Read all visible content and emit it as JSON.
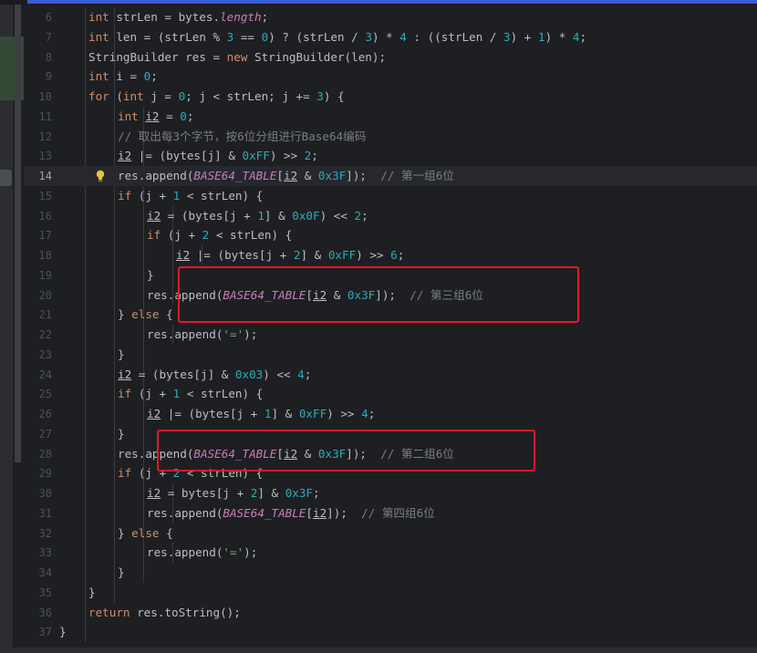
{
  "editor": {
    "lines": [
      {
        "n": "6",
        "indent": 2,
        "tokens": [
          [
            "k",
            "int"
          ],
          [
            "p",
            " strLen = bytes."
          ],
          [
            "f",
            "length"
          ],
          [
            "p",
            ";"
          ]
        ]
      },
      {
        "n": "7",
        "indent": 2,
        "tokens": [
          [
            "k",
            "int"
          ],
          [
            "p",
            " len = (strLen % "
          ],
          [
            "n",
            "3"
          ],
          [
            "p",
            " == "
          ],
          [
            "n",
            "0"
          ],
          [
            "p",
            ") ? (strLen / "
          ],
          [
            "n",
            "3"
          ],
          [
            "p",
            ") * "
          ],
          [
            "n",
            "4"
          ],
          [
            "p",
            " : ((strLen / "
          ],
          [
            "n",
            "3"
          ],
          [
            "p",
            ") + "
          ],
          [
            "n",
            "1"
          ],
          [
            "p",
            ") * "
          ],
          [
            "n",
            "4"
          ],
          [
            "p",
            ";"
          ]
        ]
      },
      {
        "n": "8",
        "indent": 2,
        "tokens": [
          [
            "p",
            "StringBuilder res = "
          ],
          [
            "k",
            "new"
          ],
          [
            "p",
            " StringBuilder(len);"
          ]
        ]
      },
      {
        "n": "9",
        "indent": 2,
        "tokens": [
          [
            "k",
            "int"
          ],
          [
            "p",
            " i = "
          ],
          [
            "n",
            "0"
          ],
          [
            "p",
            ";"
          ]
        ]
      },
      {
        "n": "10",
        "indent": 2,
        "tokens": [
          [
            "k",
            "for"
          ],
          [
            "p",
            " ("
          ],
          [
            "k",
            "int"
          ],
          [
            "p",
            " j = "
          ],
          [
            "n",
            "0"
          ],
          [
            "p",
            "; j < strLen; j += "
          ],
          [
            "n",
            "3"
          ],
          [
            "p",
            ") {"
          ]
        ]
      },
      {
        "n": "11",
        "indent": 3,
        "tokens": [
          [
            "k",
            "int"
          ],
          [
            "p",
            " "
          ],
          [
            "u",
            "i2"
          ],
          [
            "p",
            " = "
          ],
          [
            "n",
            "0"
          ],
          [
            "p",
            ";"
          ]
        ]
      },
      {
        "n": "12",
        "indent": 3,
        "tokens": [
          [
            "c",
            "// 取出每3个字节，按6位分组进行Base64编码"
          ]
        ]
      },
      {
        "n": "13",
        "indent": 3,
        "tokens": [
          [
            "u",
            "i2"
          ],
          [
            "p",
            " |= (bytes[j] & "
          ],
          [
            "n",
            "0xFF"
          ],
          [
            "p",
            ") >> "
          ],
          [
            "n",
            "2"
          ],
          [
            "p",
            ";"
          ]
        ]
      },
      {
        "n": "14",
        "indent": 3,
        "bulb": true,
        "current": true,
        "tokens": [
          [
            "p",
            "res.append("
          ],
          [
            "s",
            "BASE64_TABLE"
          ],
          [
            "p",
            "["
          ],
          [
            "u",
            "i2"
          ],
          [
            "p",
            " & "
          ],
          [
            "n",
            "0x3F"
          ],
          [
            "p",
            "]);  "
          ],
          [
            "c",
            "// 第一组6位"
          ]
        ]
      },
      {
        "n": "15",
        "indent": 3,
        "tokens": [
          [
            "k",
            "if"
          ],
          [
            "p",
            " (j + "
          ],
          [
            "n",
            "1"
          ],
          [
            "p",
            " < strLen) {"
          ]
        ]
      },
      {
        "n": "16",
        "indent": 4,
        "tokens": [
          [
            "u",
            "i2"
          ],
          [
            "p",
            " = (bytes[j + "
          ],
          [
            "n",
            "1"
          ],
          [
            "p",
            "] & "
          ],
          [
            "n",
            "0x0F"
          ],
          [
            "p",
            ") << "
          ],
          [
            "n",
            "2"
          ],
          [
            "p",
            ";"
          ]
        ]
      },
      {
        "n": "17",
        "indent": 4,
        "tokens": [
          [
            "k",
            "if"
          ],
          [
            "p",
            " (j + "
          ],
          [
            "n",
            "2"
          ],
          [
            "p",
            " < strLen) {"
          ]
        ]
      },
      {
        "n": "18",
        "indent": 5,
        "tokens": [
          [
            "u",
            "i2"
          ],
          [
            "p",
            " |= (bytes[j + "
          ],
          [
            "n",
            "2"
          ],
          [
            "p",
            "] & "
          ],
          [
            "n",
            "0xFF"
          ],
          [
            "p",
            ") >> "
          ],
          [
            "n",
            "6"
          ],
          [
            "p",
            ";"
          ]
        ]
      },
      {
        "n": "19",
        "indent": 4,
        "tokens": [
          [
            "p",
            "}"
          ]
        ]
      },
      {
        "n": "20",
        "indent": 4,
        "tokens": [
          [
            "p",
            "res.append("
          ],
          [
            "s",
            "BASE64_TABLE"
          ],
          [
            "p",
            "["
          ],
          [
            "u",
            "i2"
          ],
          [
            "p",
            " & "
          ],
          [
            "n",
            "0x3F"
          ],
          [
            "p",
            "]);  "
          ],
          [
            "c",
            "// 第三组6位"
          ]
        ]
      },
      {
        "n": "21",
        "indent": 3,
        "tokens": [
          [
            "p",
            "} "
          ],
          [
            "k",
            "else"
          ],
          [
            "p",
            " {"
          ]
        ]
      },
      {
        "n": "22",
        "indent": 4,
        "tokens": [
          [
            "p",
            "res.append("
          ],
          [
            "g",
            "'='"
          ],
          [
            "p",
            ");"
          ]
        ]
      },
      {
        "n": "23",
        "indent": 3,
        "tokens": [
          [
            "p",
            "}"
          ]
        ]
      },
      {
        "n": "24",
        "indent": 3,
        "tokens": [
          [
            "u",
            "i2"
          ],
          [
            "p",
            " = (bytes[j] & "
          ],
          [
            "n",
            "0x03"
          ],
          [
            "p",
            ") << "
          ],
          [
            "n",
            "4"
          ],
          [
            "p",
            ";"
          ]
        ]
      },
      {
        "n": "25",
        "indent": 3,
        "tokens": [
          [
            "k",
            "if"
          ],
          [
            "p",
            " (j + "
          ],
          [
            "n",
            "1"
          ],
          [
            "p",
            " < strLen) {"
          ]
        ]
      },
      {
        "n": "26",
        "indent": 4,
        "tokens": [
          [
            "u",
            "i2"
          ],
          [
            "p",
            " |= (bytes[j + "
          ],
          [
            "n",
            "1"
          ],
          [
            "p",
            "] & "
          ],
          [
            "n",
            "0xFF"
          ],
          [
            "p",
            ") >> "
          ],
          [
            "n",
            "4"
          ],
          [
            "p",
            ";"
          ]
        ]
      },
      {
        "n": "27",
        "indent": 3,
        "tokens": [
          [
            "p",
            "}"
          ]
        ]
      },
      {
        "n": "28",
        "indent": 3,
        "tokens": [
          [
            "p",
            "res.append("
          ],
          [
            "s",
            "BASE64_TABLE"
          ],
          [
            "p",
            "["
          ],
          [
            "u",
            "i2"
          ],
          [
            "p",
            " & "
          ],
          [
            "n",
            "0x3F"
          ],
          [
            "p",
            "]);  "
          ],
          [
            "c",
            "// 第二组6位"
          ]
        ]
      },
      {
        "n": "29",
        "indent": 3,
        "tokens": [
          [
            "k",
            "if"
          ],
          [
            "p",
            " (j + "
          ],
          [
            "n",
            "2"
          ],
          [
            "p",
            " < strLen) {"
          ]
        ]
      },
      {
        "n": "30",
        "indent": 4,
        "tokens": [
          [
            "u",
            "i2"
          ],
          [
            "p",
            " = bytes[j + "
          ],
          [
            "n",
            "2"
          ],
          [
            "p",
            "] & "
          ],
          [
            "n",
            "0x3F"
          ],
          [
            "p",
            ";"
          ]
        ]
      },
      {
        "n": "31",
        "indent": 4,
        "tokens": [
          [
            "p",
            "res.append("
          ],
          [
            "s",
            "BASE64_TABLE"
          ],
          [
            "p",
            "["
          ],
          [
            "u",
            "i2"
          ],
          [
            "p",
            "]);  "
          ],
          [
            "c",
            "// 第四组6位"
          ]
        ]
      },
      {
        "n": "32",
        "indent": 3,
        "tokens": [
          [
            "p",
            "} "
          ],
          [
            "k",
            "else"
          ],
          [
            "p",
            " {"
          ]
        ]
      },
      {
        "n": "33",
        "indent": 4,
        "tokens": [
          [
            "p",
            "res.append("
          ],
          [
            "g",
            "'='"
          ],
          [
            "p",
            ");"
          ]
        ]
      },
      {
        "n": "34",
        "indent": 3,
        "tokens": [
          [
            "p",
            "}"
          ]
        ]
      },
      {
        "n": "35",
        "indent": 2,
        "tokens": [
          [
            "p",
            "}"
          ]
        ]
      },
      {
        "n": "36",
        "indent": 2,
        "tokens": [
          [
            "k",
            "return"
          ],
          [
            "p",
            " res.toString();"
          ]
        ]
      },
      {
        "n": "37",
        "indent": 1,
        "tokens": [
          [
            "p",
            "}"
          ]
        ]
      }
    ]
  },
  "colors": {
    "k": "#cf8e6d",
    "n": "#2aacb8",
    "s": "#c77dbb",
    "c": "#7a7e85",
    "g": "#6aab73",
    "f": "#c77dbb",
    "p": "#bcbec4",
    "u": "#bcbec4",
    "highlight_box": "#e8162b",
    "lightbulb": "#f0c23b"
  },
  "icons": {
    "bulb": "lightbulb-icon"
  }
}
